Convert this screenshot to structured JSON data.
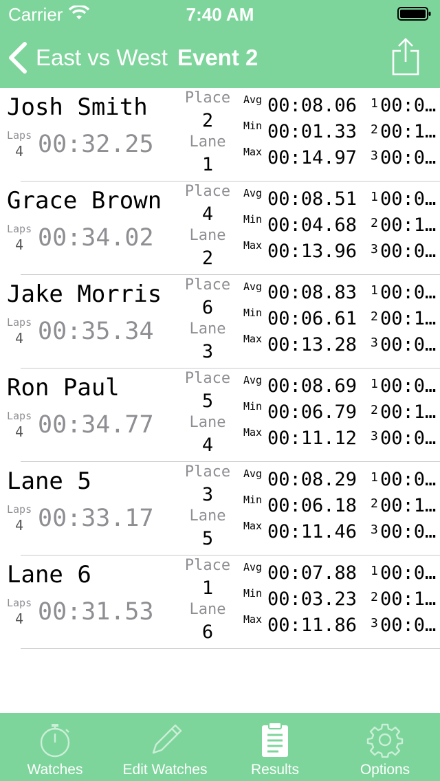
{
  "status_bar": {
    "carrier": "Carrier",
    "time": "7:40 AM"
  },
  "nav": {
    "title": "East vs West",
    "event": "Event 2"
  },
  "labels": {
    "laps": "Laps",
    "place": "Place",
    "lane": "Lane",
    "avg": "Avg",
    "min": "Min",
    "max": "Max"
  },
  "results": [
    {
      "name": "Josh Smith",
      "laps": "4",
      "total": "00:32.25",
      "place": "2",
      "lane": "1",
      "avg": "00:08.06",
      "min": "00:01.33",
      "max": "00:14.97",
      "lap1_num": "1",
      "lap1": "00:0…",
      "lap2_num": "2",
      "lap2": "00:1…",
      "lap3_num": "3",
      "lap3": "00:0…"
    },
    {
      "name": "Grace Brown",
      "laps": "4",
      "total": "00:34.02",
      "place": "4",
      "lane": "2",
      "avg": "00:08.51",
      "min": "00:04.68",
      "max": "00:13.96",
      "lap1_num": "1",
      "lap1": "00:0…",
      "lap2_num": "2",
      "lap2": "00:1…",
      "lap3_num": "3",
      "lap3": "00:0…"
    },
    {
      "name": "Jake Morris",
      "laps": "4",
      "total": "00:35.34",
      "place": "6",
      "lane": "3",
      "avg": "00:08.83",
      "min": "00:06.61",
      "max": "00:13.28",
      "lap1_num": "1",
      "lap1": "00:0…",
      "lap2_num": "2",
      "lap2": "00:1…",
      "lap3_num": "3",
      "lap3": "00:0…"
    },
    {
      "name": "Ron Paul",
      "laps": "4",
      "total": "00:34.77",
      "place": "5",
      "lane": "4",
      "avg": "00:08.69",
      "min": "00:06.79",
      "max": "00:11.12",
      "lap1_num": "1",
      "lap1": "00:0…",
      "lap2_num": "2",
      "lap2": "00:1…",
      "lap3_num": "3",
      "lap3": "00:0…"
    },
    {
      "name": "Lane 5",
      "laps": "4",
      "total": "00:33.17",
      "place": "3",
      "lane": "5",
      "avg": "00:08.29",
      "min": "00:06.18",
      "max": "00:11.46",
      "lap1_num": "1",
      "lap1": "00:0…",
      "lap2_num": "2",
      "lap2": "00:1…",
      "lap3_num": "3",
      "lap3": "00:0…"
    },
    {
      "name": "Lane 6",
      "laps": "4",
      "total": "00:31.53",
      "place": "1",
      "lane": "6",
      "avg": "00:07.88",
      "min": "00:03.23",
      "max": "00:11.86",
      "lap1_num": "1",
      "lap1": "00:0…",
      "lap2_num": "2",
      "lap2": "00:1…",
      "lap3_num": "3",
      "lap3": "00:0…"
    }
  ],
  "tabs": [
    {
      "label": "Watches",
      "icon": "stopwatch-icon",
      "selected": false
    },
    {
      "label": "Edit Watches",
      "icon": "pencil-icon",
      "selected": false
    },
    {
      "label": "Results",
      "icon": "clipboard-icon",
      "selected": true
    },
    {
      "label": "Options",
      "icon": "gear-icon",
      "selected": false
    }
  ],
  "colors": {
    "accent": "#7dd59b"
  }
}
